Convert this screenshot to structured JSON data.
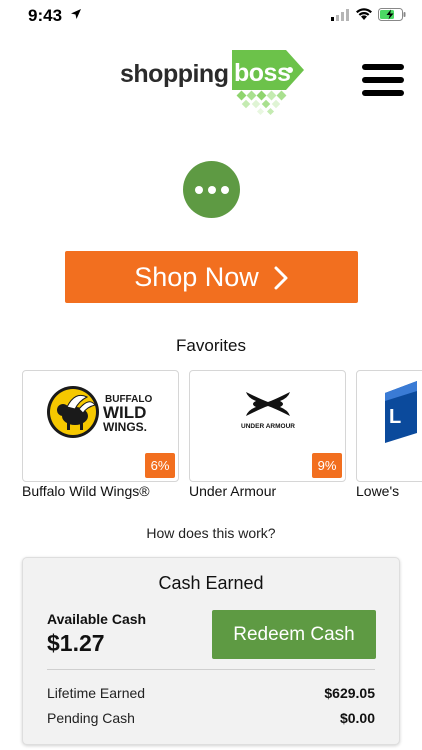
{
  "status_bar": {
    "time": "9:43",
    "icons": [
      "location-arrow-icon",
      "cell-signal-icon",
      "wifi-icon",
      "battery-charging-icon"
    ]
  },
  "header": {
    "logo_part1": "shopping",
    "logo_part2": "boss",
    "menu_icon": "hamburger-menu-icon"
  },
  "more_button_icon": "ellipsis-icon",
  "shop_now": {
    "label": "Shop Now",
    "icon": "chevron-right-icon"
  },
  "favorites": {
    "title": "Favorites",
    "items": [
      {
        "name": "Buffalo Wild Wings®",
        "badge": "6%",
        "logo_text": [
          "BUFFALO",
          "WILD",
          "WINGS."
        ]
      },
      {
        "name": "Under Armour",
        "badge": "9%",
        "logo_text": [
          "UNDER ARMOUR"
        ]
      },
      {
        "name": "Lowe's"
      }
    ]
  },
  "how_link": "How does this work?",
  "cash": {
    "title": "Cash Earned",
    "available_label": "Available Cash",
    "available_value": "$1.27",
    "redeem_label": "Redeem Cash",
    "rows": [
      {
        "label": "Lifetime Earned",
        "value": "$629.05"
      },
      {
        "label": "Pending Cash",
        "value": "$0.00"
      }
    ]
  },
  "colors": {
    "brand_green": "#5e9a43",
    "brand_orange": "#f26f1f",
    "logo_green": "#6cc24a"
  }
}
